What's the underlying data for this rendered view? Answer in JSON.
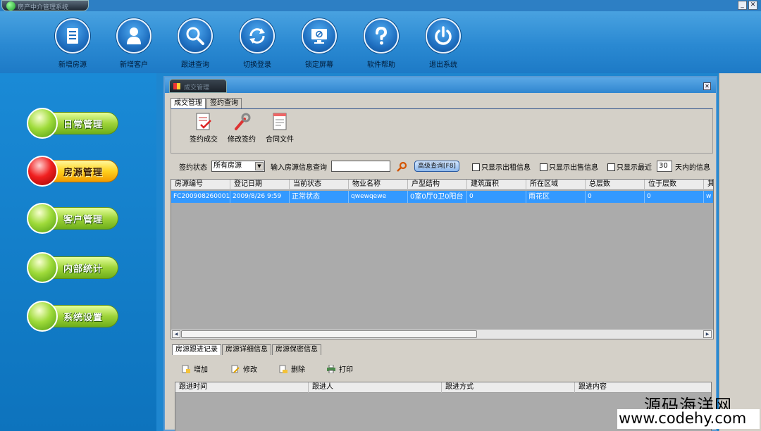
{
  "titlebar": {
    "title": "房产中介管理系统",
    "minimize_icon": "minimize-icon",
    "close_icon": "close-icon"
  },
  "toolbar": {
    "items": [
      {
        "label": "新增房源",
        "icon": "house-document-icon"
      },
      {
        "label": "新增客户",
        "icon": "user-icon"
      },
      {
        "label": "跟进查询",
        "icon": "magnifier-icon"
      },
      {
        "label": "切换登录",
        "icon": "refresh-icon"
      },
      {
        "label": "锁定屏幕",
        "icon": "monitor-lock-icon"
      },
      {
        "label": "软件帮助",
        "icon": "help-icon"
      },
      {
        "label": "退出系统",
        "icon": "power-icon"
      }
    ]
  },
  "leftnav": {
    "items": [
      {
        "label": "日常管理",
        "active": false
      },
      {
        "label": "房源管理",
        "active": true
      },
      {
        "label": "客户管理",
        "active": false
      },
      {
        "label": "内部统计",
        "active": false
      },
      {
        "label": "系统设置",
        "active": false
      }
    ]
  },
  "window": {
    "title": "成交管理",
    "tabs": [
      {
        "label": "成交管理",
        "active": true
      },
      {
        "label": "签约查询",
        "active": false
      }
    ],
    "actions": [
      {
        "label": "签约成交",
        "icon": "sign-contract-icon"
      },
      {
        "label": "修改签约",
        "icon": "wrench-icon"
      },
      {
        "label": "合同文件",
        "icon": "contract-file-icon"
      }
    ],
    "filters": {
      "status_label": "签约状态",
      "status_value": "所有房源",
      "search_label": "输入房源信息查询",
      "search_value": "",
      "adv_search": "高级查询[F8]",
      "rent_only": "只显示出租信息",
      "sale_only": "只显示出售信息",
      "recent_prefix": "只显示最近",
      "recent_days": "30",
      "recent_suffix": "天内的信息"
    },
    "grid": {
      "columns": [
        "房源编号",
        "登记日期",
        "当前状态",
        "物业名称",
        "户型结构",
        "建筑面积",
        "所在区域",
        "总层数",
        "位于层数",
        "其"
      ],
      "rows": [
        [
          "FC200908260001",
          "2009/8/26 9:59",
          "正常状态",
          "qwewqewe",
          "0室0厅0卫0阳台",
          "0",
          "雨花区",
          "0",
          "0",
          "w"
        ]
      ]
    },
    "bottom_tabs": [
      {
        "label": "房源跟进记录",
        "active": true
      },
      {
        "label": "房源详细信息",
        "active": false
      },
      {
        "label": "房源保密信息",
        "active": false
      }
    ],
    "bottom_actions": [
      {
        "label": "增加",
        "icon": "add-doc-icon"
      },
      {
        "label": "修改",
        "icon": "edit-doc-icon"
      },
      {
        "label": "删除",
        "icon": "delete-doc-icon"
      },
      {
        "label": "打印",
        "icon": "printer-icon"
      }
    ],
    "followup_grid": {
      "columns": [
        "跟进时间",
        "跟进人",
        "跟进方式",
        "跟进内容"
      ]
    }
  },
  "watermark": {
    "line1": "源码海洋网",
    "line2": "www.codehy.com"
  }
}
